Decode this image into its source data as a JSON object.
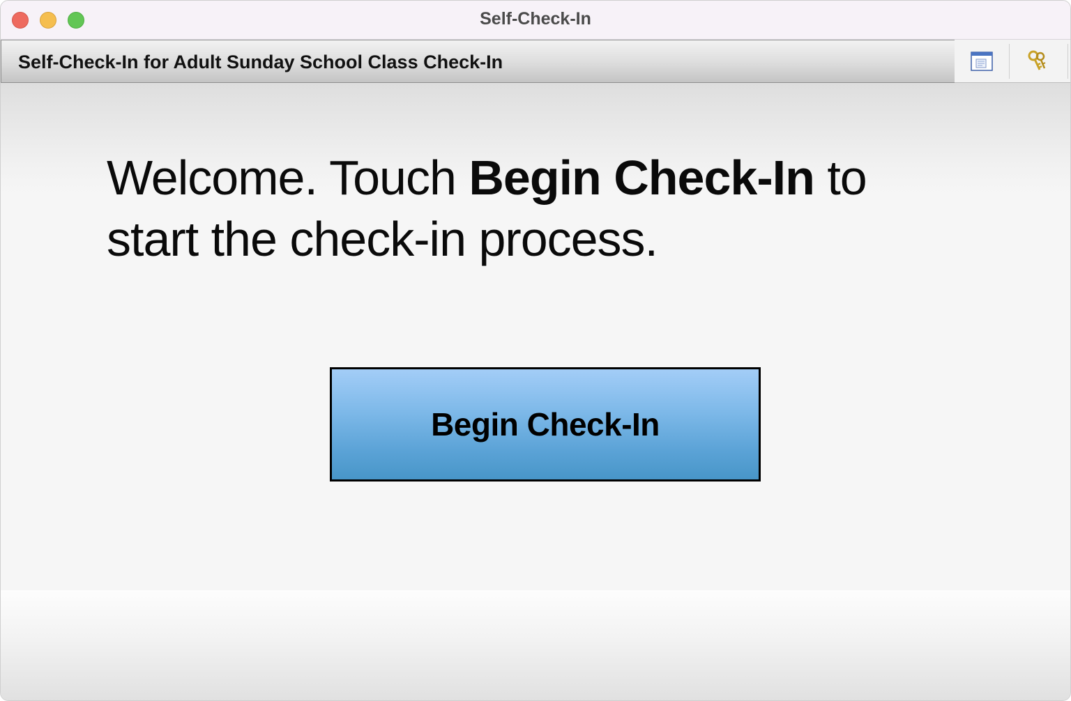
{
  "window": {
    "title": "Self-Check-In"
  },
  "header": {
    "title": "Self-Check-In for Adult Sunday School Class Check-In",
    "tools": [
      {
        "name": "window-icon"
      },
      {
        "name": "keys-icon"
      }
    ]
  },
  "main": {
    "welcome_prefix": "Welcome. Touch ",
    "welcome_bold": "Begin Check-In",
    "welcome_suffix": " to start the check-in process.",
    "button_label": "Begin Check-In"
  },
  "colors": {
    "button_top": "#a3cdf7",
    "button_bottom": "#4896c8",
    "close": "#ee6a5f",
    "minimize": "#f5be4f",
    "maximize": "#62c655"
  }
}
